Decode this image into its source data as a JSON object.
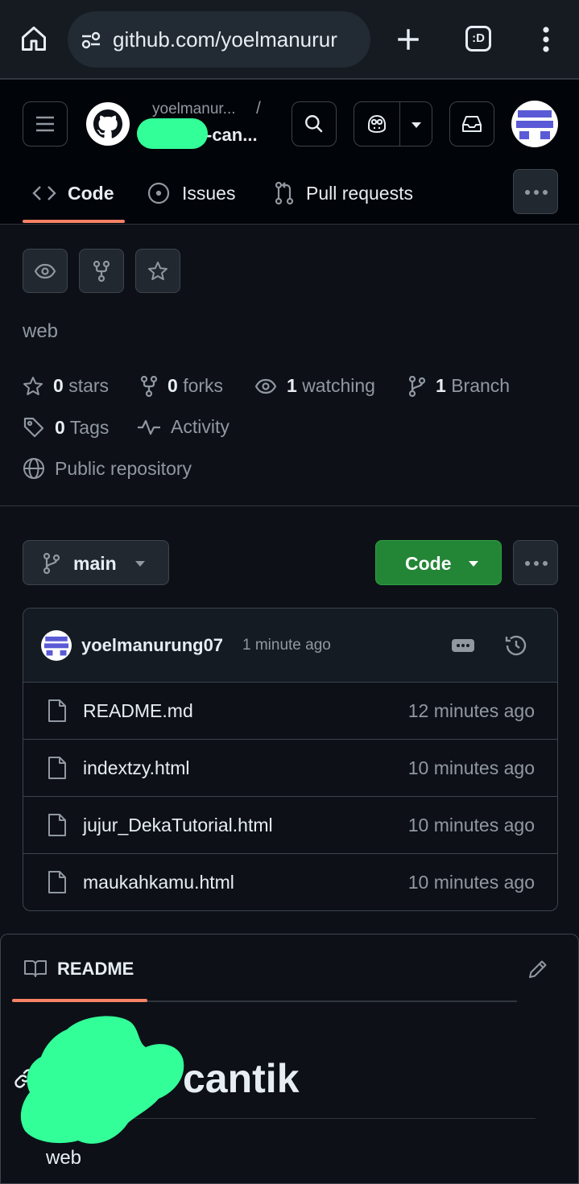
{
  "browser": {
    "url": "github.com/yoelmanurur",
    "tab_badge": ":D"
  },
  "header": {
    "owner": "yoelmanur...",
    "separator": "/",
    "repo": "-can..."
  },
  "tabs": [
    {
      "label": "Code",
      "active": true
    },
    {
      "label": "Issues",
      "active": false
    },
    {
      "label": "Pull requests",
      "active": false
    }
  ],
  "repo": {
    "description": "web",
    "stats": {
      "stars_count": "0",
      "stars_label": "stars",
      "forks_count": "0",
      "forks_label": "forks",
      "watching_count": "1",
      "watching_label": "watching",
      "branch_count": "1",
      "branch_label": "Branch",
      "tags_count": "0",
      "tags_label": "Tags",
      "activity_label": "Activity",
      "visibility_label": "Public repository"
    }
  },
  "toolbar": {
    "branch": "main",
    "code_button": "Code"
  },
  "commit": {
    "author": "yoelmanurung07",
    "time": "1 minute ago"
  },
  "files": [
    {
      "name": "README.md",
      "time": "12 minutes ago"
    },
    {
      "name": "indextzy.html",
      "time": "10 minutes ago"
    },
    {
      "name": "jujur_DekaTutorial.html",
      "time": "10 minutes ago"
    },
    {
      "name": "maukahkamu.html",
      "time": "10 minutes ago"
    }
  ],
  "readme": {
    "tab_label": "README",
    "heading": "cantik",
    "body": "web"
  },
  "colors": {
    "background": "#0d1117",
    "header_bg": "#010409",
    "accent_orange": "#f78166",
    "green_button": "#238636",
    "redaction": "#33ff99",
    "avatar_blue": "#5a5ad6"
  }
}
